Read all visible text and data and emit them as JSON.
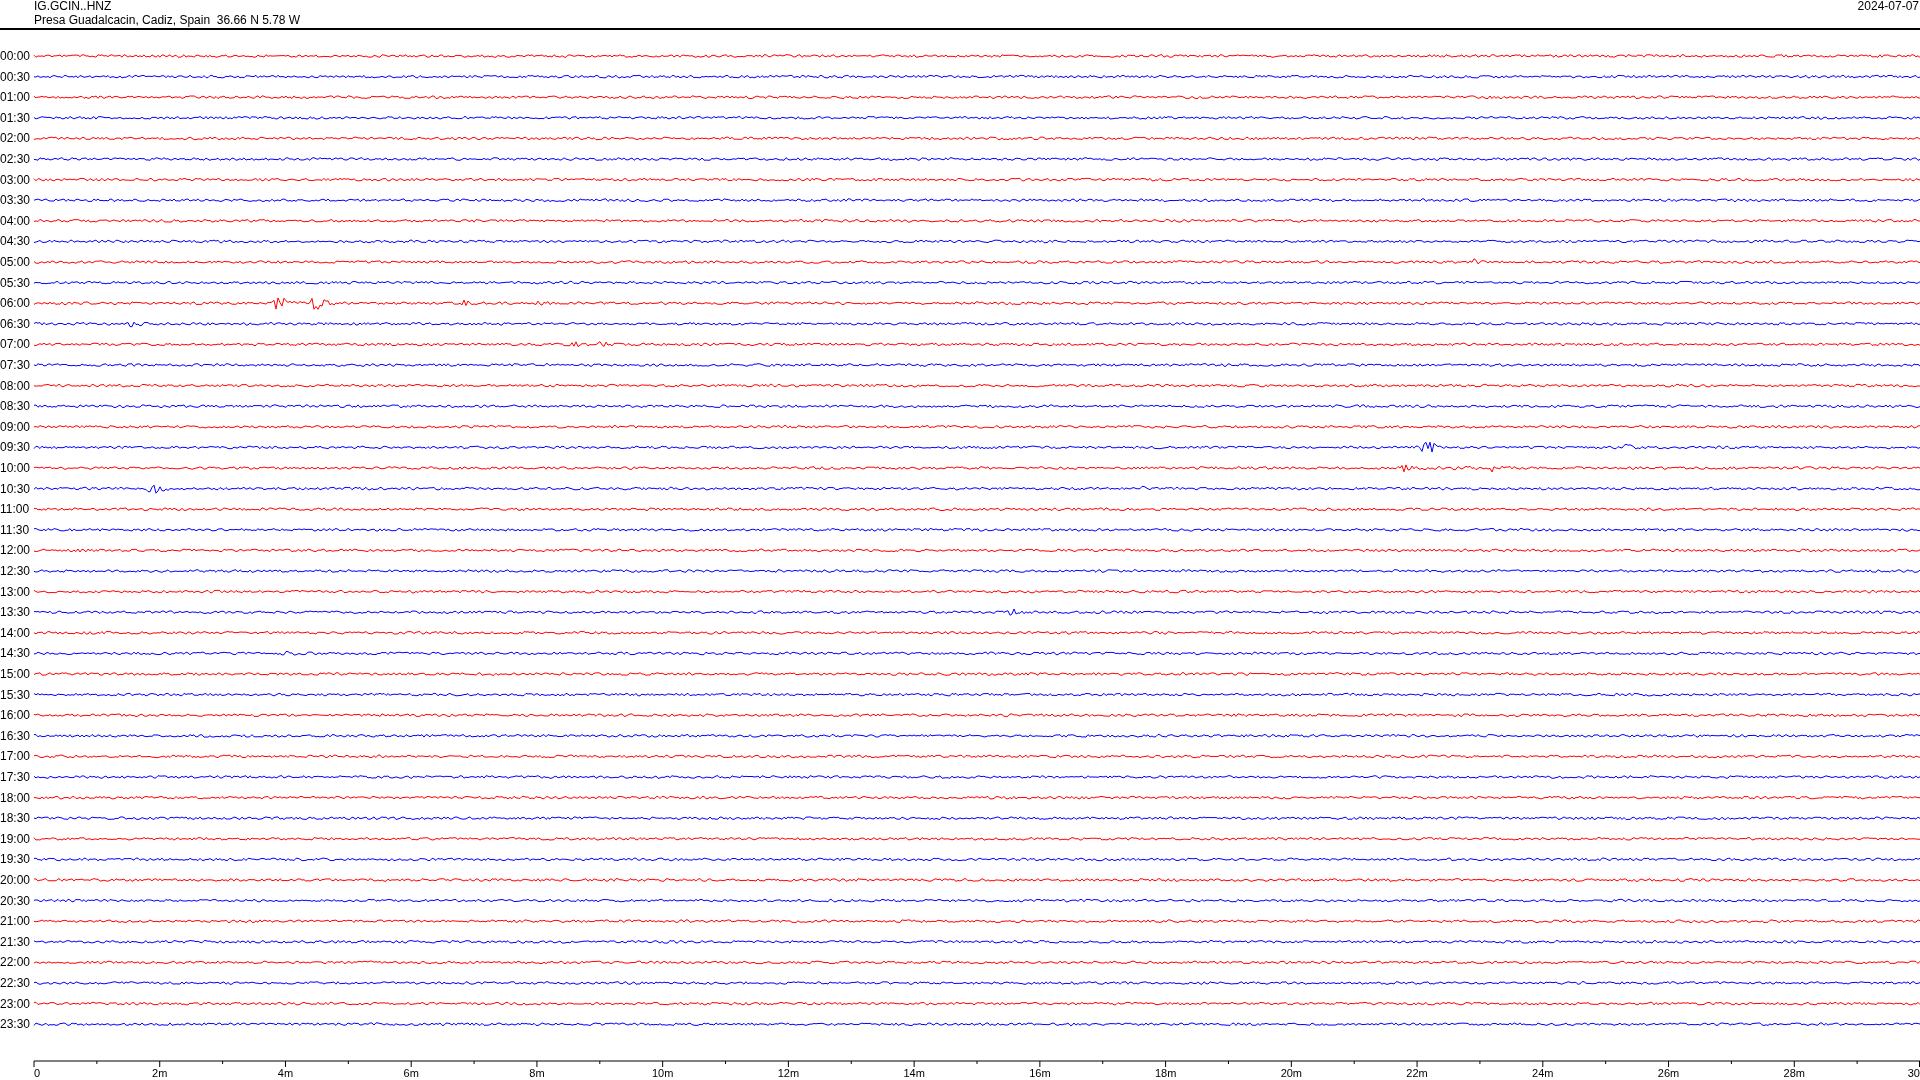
{
  "header": {
    "station": "IG.GCIN..HNZ",
    "location": "Presa Guadalcacin, Cadiz, Spain  36.66 N 5.78 W",
    "date": "2024-07-07"
  },
  "rows": [
    {
      "time": "00:00",
      "color": "#ff0000"
    },
    {
      "time": "00:30",
      "color": "#0000ff"
    },
    {
      "time": "01:00",
      "color": "#ff0000"
    },
    {
      "time": "01:30",
      "color": "#0000ff"
    },
    {
      "time": "02:00",
      "color": "#ff0000"
    },
    {
      "time": "02:30",
      "color": "#0000ff"
    },
    {
      "time": "03:00",
      "color": "#ff0000"
    },
    {
      "time": "03:30",
      "color": "#0000ff"
    },
    {
      "time": "04:00",
      "color": "#ff0000"
    },
    {
      "time": "04:30",
      "color": "#0000ff"
    },
    {
      "time": "05:00",
      "color": "#ff0000"
    },
    {
      "time": "05:30",
      "color": "#0000ff"
    },
    {
      "time": "06:00",
      "color": "#ff0000"
    },
    {
      "time": "06:30",
      "color": "#0000ff"
    },
    {
      "time": "07:00",
      "color": "#ff0000"
    },
    {
      "time": "07:30",
      "color": "#0000ff"
    },
    {
      "time": "08:00",
      "color": "#ff0000"
    },
    {
      "time": "08:30",
      "color": "#0000ff"
    },
    {
      "time": "09:00",
      "color": "#ff0000"
    },
    {
      "time": "09:30",
      "color": "#0000ff"
    },
    {
      "time": "10:00",
      "color": "#ff0000"
    },
    {
      "time": "10:30",
      "color": "#0000ff"
    },
    {
      "time": "11:00",
      "color": "#ff0000"
    },
    {
      "time": "11:30",
      "color": "#0000ff"
    },
    {
      "time": "12:00",
      "color": "#ff0000"
    },
    {
      "time": "12:30",
      "color": "#0000ff"
    },
    {
      "time": "13:00",
      "color": "#ff0000"
    },
    {
      "time": "13:30",
      "color": "#0000ff"
    },
    {
      "time": "14:00",
      "color": "#ff0000"
    },
    {
      "time": "14:30",
      "color": "#0000ff"
    },
    {
      "time": "15:00",
      "color": "#ff0000"
    },
    {
      "time": "15:30",
      "color": "#0000ff"
    },
    {
      "time": "16:00",
      "color": "#ff0000"
    },
    {
      "time": "16:30",
      "color": "#0000ff"
    },
    {
      "time": "17:00",
      "color": "#ff0000"
    },
    {
      "time": "17:30",
      "color": "#0000ff"
    },
    {
      "time": "18:00",
      "color": "#ff0000"
    },
    {
      "time": "18:30",
      "color": "#0000ff"
    },
    {
      "time": "19:00",
      "color": "#ff0000"
    },
    {
      "time": "19:30",
      "color": "#0000ff"
    },
    {
      "time": "20:00",
      "color": "#ff0000"
    },
    {
      "time": "20:30",
      "color": "#0000ff"
    },
    {
      "time": "21:00",
      "color": "#ff0000"
    },
    {
      "time": "21:30",
      "color": "#0000ff"
    },
    {
      "time": "22:00",
      "color": "#ff0000"
    },
    {
      "time": "22:30",
      "color": "#0000ff"
    },
    {
      "time": "23:00",
      "color": "#ff0000"
    },
    {
      "time": "23:30",
      "color": "#0000ff"
    }
  ],
  "axis": {
    "labels": [
      "0",
      "2m",
      "4m",
      "6m",
      "8m",
      "10m",
      "12m",
      "14m",
      "16m",
      "18m",
      "20m",
      "22m",
      "24m",
      "26m",
      "28m",
      "30"
    ]
  }
}
